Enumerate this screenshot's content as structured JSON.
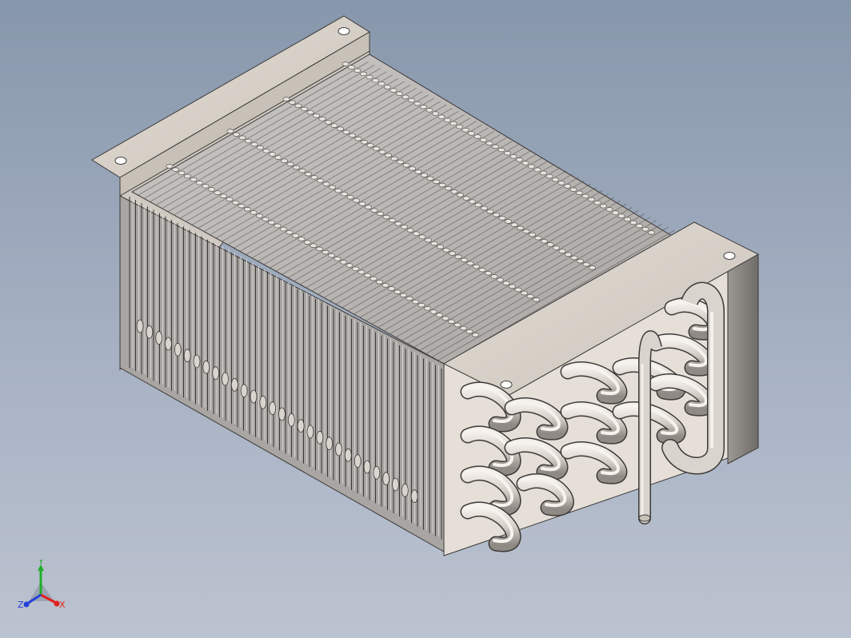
{
  "viewport": {
    "background_top": "#8797ab",
    "background_bottom": "#bcc3d0"
  },
  "model": {
    "name_icon": "finned-tube-heat-exchanger",
    "sheet_color": "#d6cfc6",
    "sheet_edge_color": "#3c3a38",
    "fin_color": "#b9b7b5",
    "tube_color": "#d9d4cd",
    "tube_shade": "#8f8a84"
  },
  "triad": {
    "x_label": "X",
    "y_label": "Y",
    "z_label": "Z",
    "x_color": "#e0201c",
    "y_color": "#1fae2a",
    "z_color": "#2340d8"
  }
}
